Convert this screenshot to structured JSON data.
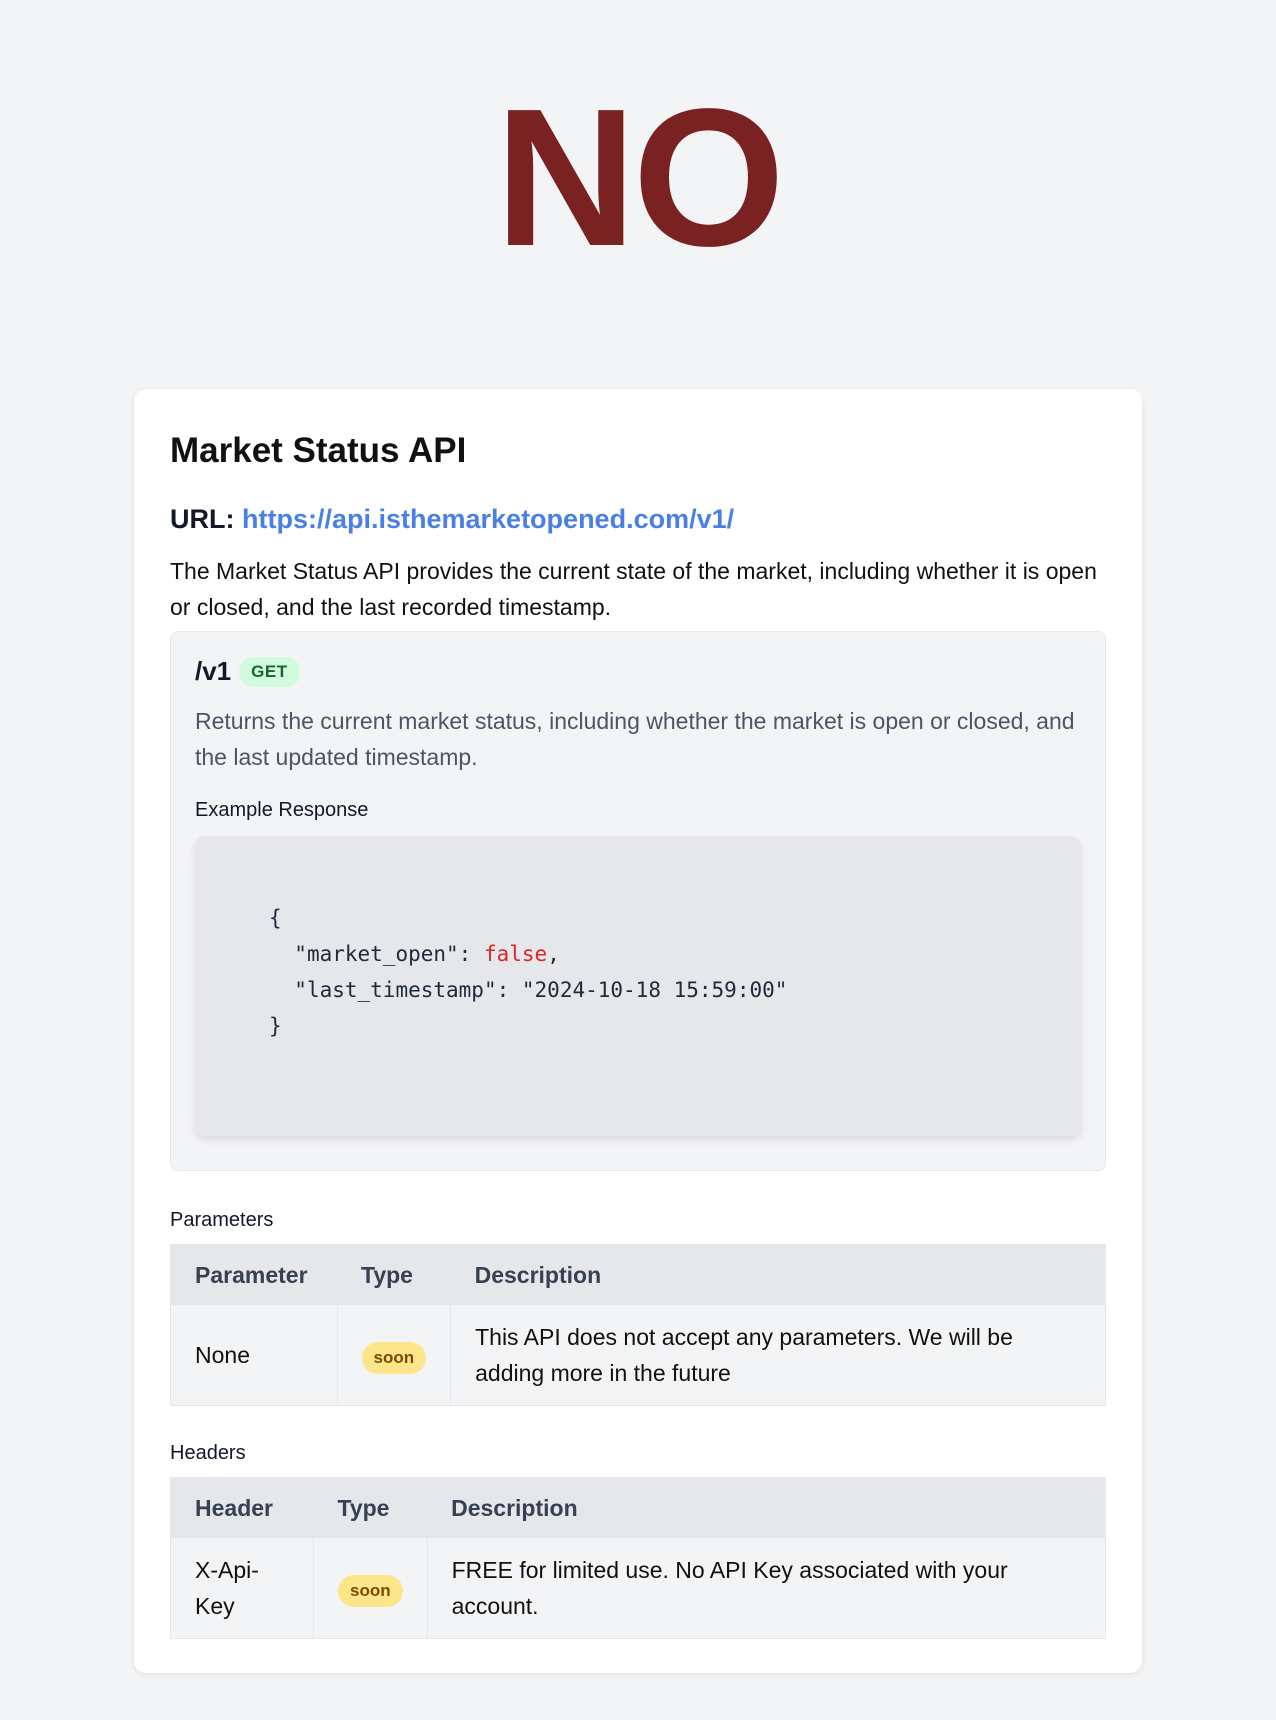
{
  "hero": {
    "status": "NO",
    "color": "#7a2222"
  },
  "api": {
    "title": "Market Status API",
    "url_label": "URL:",
    "url": "https://api.isthemarketopened.com/v1/",
    "intro": "The Market Status API provides the current state of the market, including whether it is open or closed, and the last recorded timestamp."
  },
  "endpoint": {
    "path": "/v1",
    "method": "GET",
    "description": "Returns the current market status, including whether the market is open or closed, and the last updated timestamp.",
    "example_label": "Example Response",
    "example": {
      "open_brace": "{",
      "key1": "\"market_open\"",
      "val1": "false",
      "key2": "\"last_timestamp\"",
      "val2": "\"2024-10-18 15:59:00\"",
      "close_brace": "}"
    }
  },
  "parameters": {
    "label": "Parameters",
    "headers": [
      "Parameter",
      "Type",
      "Description"
    ],
    "rows": [
      {
        "name": "None",
        "type": "soon",
        "description": "This API does not accept any parameters. We will be adding more in the future"
      }
    ]
  },
  "headers_section": {
    "label": "Headers",
    "headers": [
      "Header",
      "Type",
      "Description"
    ],
    "rows": [
      {
        "name": "X-Api-Key",
        "type": "soon",
        "description": "FREE for limited use. No API Key associated with your account."
      }
    ]
  }
}
